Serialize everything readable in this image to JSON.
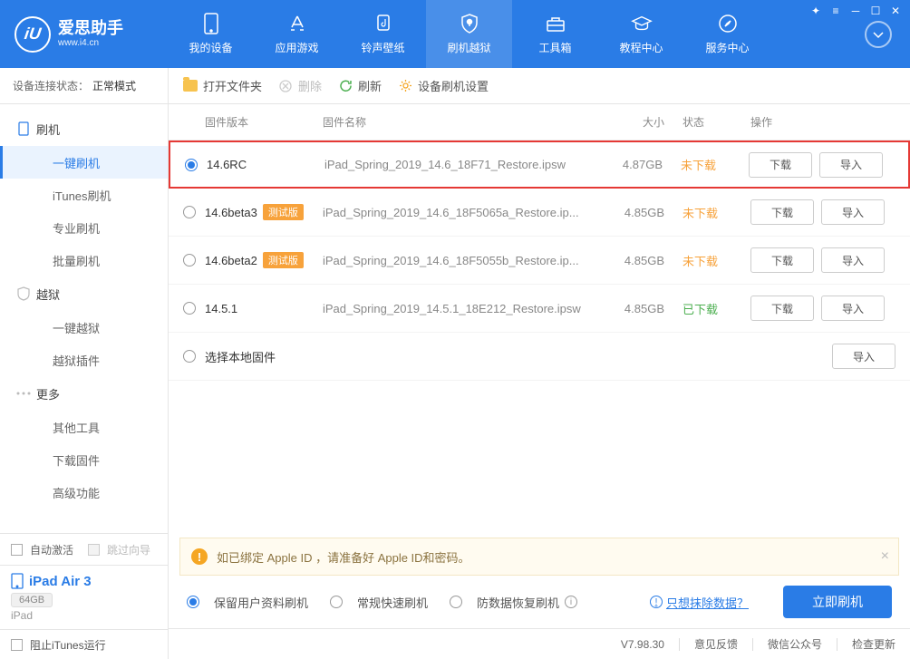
{
  "app": {
    "title": "爱思助手",
    "subtitle": "www.i4.cn"
  },
  "nav": {
    "device": "我的设备",
    "apps": "应用游戏",
    "ringtone": "铃声壁纸",
    "flash": "刷机越狱",
    "tools": "工具箱",
    "tutorial": "教程中心",
    "service": "服务中心"
  },
  "connection": {
    "label": "设备连接状态",
    "value": "正常模式"
  },
  "sidebar": {
    "flash": "刷机",
    "oneKeyFlash": "一键刷机",
    "itunesFlash": "iTunes刷机",
    "proFlash": "专业刷机",
    "batchFlash": "批量刷机",
    "jailbreak": "越狱",
    "oneKeyJailbreak": "一键越狱",
    "jailbreakPlugin": "越狱插件",
    "more": "更多",
    "otherTools": "其他工具",
    "downloadFw": "下载固件",
    "advanced": "高级功能"
  },
  "sideBottom": {
    "autoActivate": "自动激活",
    "skipWizard": "跳过向导",
    "deviceName": "iPad Air 3",
    "storage": "64GB",
    "deviceType": "iPad",
    "blockItunes": "阻止iTunes运行"
  },
  "toolbar": {
    "openFolder": "打开文件夹",
    "delete": "删除",
    "refresh": "刷新",
    "settings": "设备刷机设置"
  },
  "columns": {
    "version": "固件版本",
    "name": "固件名称",
    "size": "大小",
    "status": "状态",
    "action": "操作"
  },
  "badges": {
    "beta": "测试版"
  },
  "statuses": {
    "notDownloaded": "未下载",
    "downloaded": "已下载"
  },
  "actions": {
    "download": "下载",
    "import": "导入"
  },
  "rows": [
    {
      "version": "14.6RC",
      "beta": false,
      "name": "iPad_Spring_2019_14.6_18F71_Restore.ipsw",
      "size": "4.87GB",
      "status": "notDownloaded",
      "selected": true,
      "highlighted": true
    },
    {
      "version": "14.6beta3",
      "beta": true,
      "name": "iPad_Spring_2019_14.6_18F5065a_Restore.ip...",
      "size": "4.85GB",
      "status": "notDownloaded"
    },
    {
      "version": "14.6beta2",
      "beta": true,
      "name": "iPad_Spring_2019_14.6_18F5055b_Restore.ip...",
      "size": "4.85GB",
      "status": "notDownloaded"
    },
    {
      "version": "14.5.1",
      "beta": false,
      "name": "iPad_Spring_2019_14.5.1_18E212_Restore.ipsw",
      "size": "4.85GB",
      "status": "downloaded"
    }
  ],
  "localRow": {
    "label": "选择本地固件"
  },
  "warning": "如已绑定 Apple ID ，请准备好 Apple ID和密码。",
  "flashOptions": {
    "keepData": "保留用户资料刷机",
    "normal": "常规快速刷机",
    "antiRecovery": "防数据恢复刷机",
    "eraseLink": "只想抹除数据？",
    "flashNow": "立即刷机"
  },
  "statusbar": {
    "version": "V7.98.30",
    "feedback": "意见反馈",
    "wechat": "微信公众号",
    "checkUpdate": "检查更新"
  }
}
